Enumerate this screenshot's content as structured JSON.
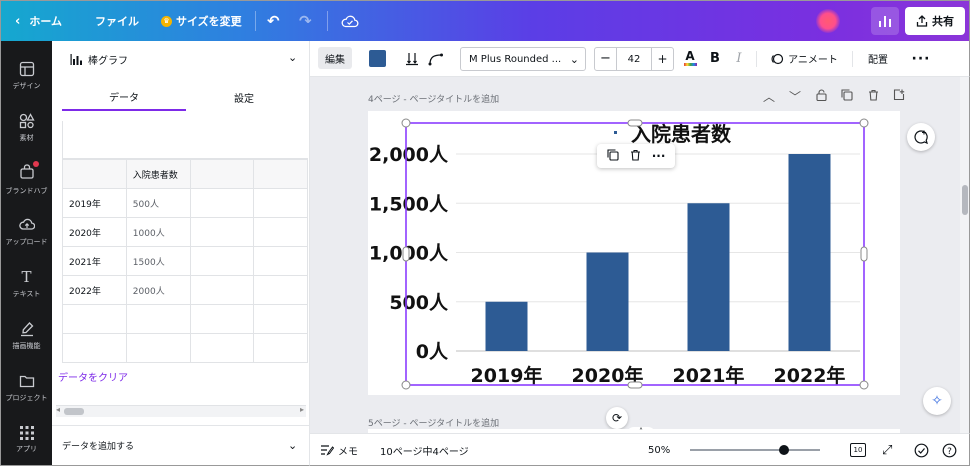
{
  "topbar": {
    "home_label": "ホーム",
    "file_label": "ファイル",
    "resize_label": "サイズを変更",
    "share_label": "共有"
  },
  "rail": {
    "items": [
      {
        "label": "デザイン",
        "icon": "layout-icon"
      },
      {
        "label": "素材",
        "icon": "shapes-icon"
      },
      {
        "label": "ブランドハブ",
        "icon": "brand-icon"
      },
      {
        "label": "アップロード",
        "icon": "upload-icon"
      },
      {
        "label": "テキスト",
        "icon": "text-icon"
      },
      {
        "label": "描画機能",
        "icon": "draw-icon"
      },
      {
        "label": "プロジェクト",
        "icon": "folder-icon"
      },
      {
        "label": "アプリ",
        "icon": "apps-icon"
      }
    ]
  },
  "panel": {
    "chart_type": "棒グラフ",
    "tab_data": "データ",
    "tab_settings": "設定",
    "table": {
      "header": [
        "",
        "入院患者数"
      ],
      "rows": [
        [
          "2019年",
          "500人"
        ],
        [
          "2020年",
          "1000人"
        ],
        [
          "2021年",
          "1500人"
        ],
        [
          "2022年",
          "2000人"
        ]
      ]
    },
    "clear_label": "データをクリア",
    "add_data_label": "データを追加する"
  },
  "toolbar": {
    "edit_label": "編集",
    "color": "#2d5b94",
    "font_name": "M Plus Rounded ...",
    "font_size": "42",
    "animate_label": "アニメート",
    "position_label": "配置"
  },
  "page": {
    "label": "4ページ - ページタイトルを追加",
    "next_label": "5ページ - ページタイトルを追加"
  },
  "bottombar": {
    "notes_label": "メモ",
    "page_count": "10ページ中4ページ",
    "zoom": "50%",
    "zoom_fraction": 0.72,
    "page_badge": "10"
  },
  "chart_data": {
    "type": "bar",
    "title": "入院患者数",
    "categories": [
      "2019年",
      "2020年",
      "2021年",
      "2022年"
    ],
    "values": [
      500,
      1000,
      1500,
      2000
    ],
    "ylim": [
      0,
      2000
    ],
    "yticks": [
      "0人",
      "500人",
      "1,000人",
      "1,500人",
      "2,000人"
    ],
    "bar_color": "#2d5b94",
    "grid": true
  }
}
